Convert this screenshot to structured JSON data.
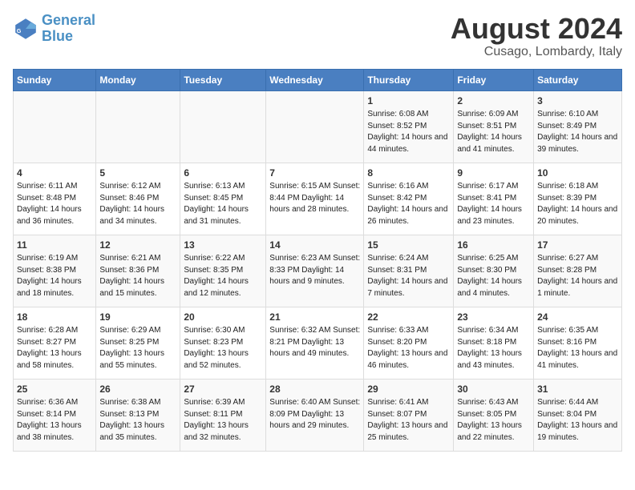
{
  "logo": {
    "line1": "General",
    "line2": "Blue"
  },
  "title": "August 2024",
  "subtitle": "Cusago, Lombardy, Italy",
  "weekdays": [
    "Sunday",
    "Monday",
    "Tuesday",
    "Wednesday",
    "Thursday",
    "Friday",
    "Saturday"
  ],
  "weeks": [
    [
      {
        "day": "",
        "content": ""
      },
      {
        "day": "",
        "content": ""
      },
      {
        "day": "",
        "content": ""
      },
      {
        "day": "",
        "content": ""
      },
      {
        "day": "1",
        "content": "Sunrise: 6:08 AM\nSunset: 8:52 PM\nDaylight: 14 hours\nand 44 minutes."
      },
      {
        "day": "2",
        "content": "Sunrise: 6:09 AM\nSunset: 8:51 PM\nDaylight: 14 hours\nand 41 minutes."
      },
      {
        "day": "3",
        "content": "Sunrise: 6:10 AM\nSunset: 8:49 PM\nDaylight: 14 hours\nand 39 minutes."
      }
    ],
    [
      {
        "day": "4",
        "content": "Sunrise: 6:11 AM\nSunset: 8:48 PM\nDaylight: 14 hours\nand 36 minutes."
      },
      {
        "day": "5",
        "content": "Sunrise: 6:12 AM\nSunset: 8:46 PM\nDaylight: 14 hours\nand 34 minutes."
      },
      {
        "day": "6",
        "content": "Sunrise: 6:13 AM\nSunset: 8:45 PM\nDaylight: 14 hours\nand 31 minutes."
      },
      {
        "day": "7",
        "content": "Sunrise: 6:15 AM\nSunset: 8:44 PM\nDaylight: 14 hours\nand 28 minutes."
      },
      {
        "day": "8",
        "content": "Sunrise: 6:16 AM\nSunset: 8:42 PM\nDaylight: 14 hours\nand 26 minutes."
      },
      {
        "day": "9",
        "content": "Sunrise: 6:17 AM\nSunset: 8:41 PM\nDaylight: 14 hours\nand 23 minutes."
      },
      {
        "day": "10",
        "content": "Sunrise: 6:18 AM\nSunset: 8:39 PM\nDaylight: 14 hours\nand 20 minutes."
      }
    ],
    [
      {
        "day": "11",
        "content": "Sunrise: 6:19 AM\nSunset: 8:38 PM\nDaylight: 14 hours\nand 18 minutes."
      },
      {
        "day": "12",
        "content": "Sunrise: 6:21 AM\nSunset: 8:36 PM\nDaylight: 14 hours\nand 15 minutes."
      },
      {
        "day": "13",
        "content": "Sunrise: 6:22 AM\nSunset: 8:35 PM\nDaylight: 14 hours\nand 12 minutes."
      },
      {
        "day": "14",
        "content": "Sunrise: 6:23 AM\nSunset: 8:33 PM\nDaylight: 14 hours\nand 9 minutes."
      },
      {
        "day": "15",
        "content": "Sunrise: 6:24 AM\nSunset: 8:31 PM\nDaylight: 14 hours\nand 7 minutes."
      },
      {
        "day": "16",
        "content": "Sunrise: 6:25 AM\nSunset: 8:30 PM\nDaylight: 14 hours\nand 4 minutes."
      },
      {
        "day": "17",
        "content": "Sunrise: 6:27 AM\nSunset: 8:28 PM\nDaylight: 14 hours\nand 1 minute."
      }
    ],
    [
      {
        "day": "18",
        "content": "Sunrise: 6:28 AM\nSunset: 8:27 PM\nDaylight: 13 hours\nand 58 minutes."
      },
      {
        "day": "19",
        "content": "Sunrise: 6:29 AM\nSunset: 8:25 PM\nDaylight: 13 hours\nand 55 minutes."
      },
      {
        "day": "20",
        "content": "Sunrise: 6:30 AM\nSunset: 8:23 PM\nDaylight: 13 hours\nand 52 minutes."
      },
      {
        "day": "21",
        "content": "Sunrise: 6:32 AM\nSunset: 8:21 PM\nDaylight: 13 hours\nand 49 minutes."
      },
      {
        "day": "22",
        "content": "Sunrise: 6:33 AM\nSunset: 8:20 PM\nDaylight: 13 hours\nand 46 minutes."
      },
      {
        "day": "23",
        "content": "Sunrise: 6:34 AM\nSunset: 8:18 PM\nDaylight: 13 hours\nand 43 minutes."
      },
      {
        "day": "24",
        "content": "Sunrise: 6:35 AM\nSunset: 8:16 PM\nDaylight: 13 hours\nand 41 minutes."
      }
    ],
    [
      {
        "day": "25",
        "content": "Sunrise: 6:36 AM\nSunset: 8:14 PM\nDaylight: 13 hours\nand 38 minutes."
      },
      {
        "day": "26",
        "content": "Sunrise: 6:38 AM\nSunset: 8:13 PM\nDaylight: 13 hours\nand 35 minutes."
      },
      {
        "day": "27",
        "content": "Sunrise: 6:39 AM\nSunset: 8:11 PM\nDaylight: 13 hours\nand 32 minutes."
      },
      {
        "day": "28",
        "content": "Sunrise: 6:40 AM\nSunset: 8:09 PM\nDaylight: 13 hours\nand 29 minutes."
      },
      {
        "day": "29",
        "content": "Sunrise: 6:41 AM\nSunset: 8:07 PM\nDaylight: 13 hours\nand 25 minutes."
      },
      {
        "day": "30",
        "content": "Sunrise: 6:43 AM\nSunset: 8:05 PM\nDaylight: 13 hours\nand 22 minutes."
      },
      {
        "day": "31",
        "content": "Sunrise: 6:44 AM\nSunset: 8:04 PM\nDaylight: 13 hours\nand 19 minutes."
      }
    ]
  ]
}
